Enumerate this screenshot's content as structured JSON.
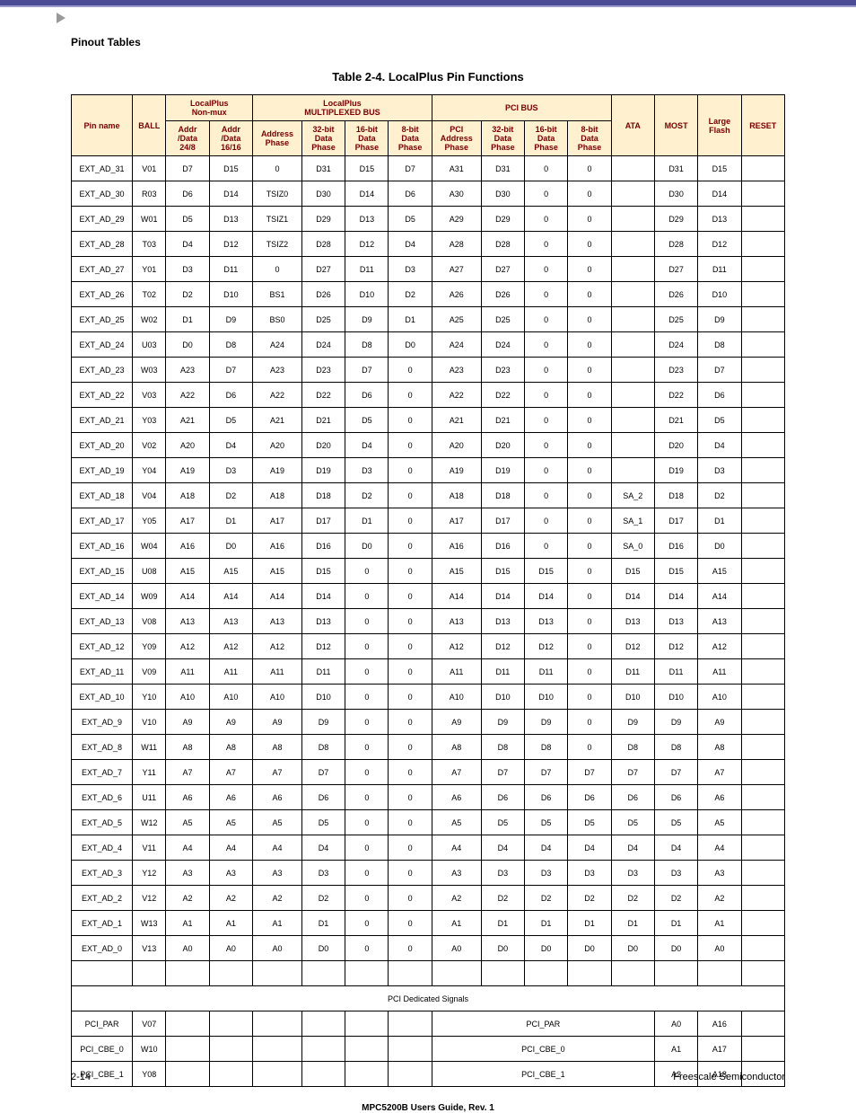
{
  "section_header": "Pinout Tables",
  "table_title": "Table 2-4. LocalPlus Pin Functions",
  "footer_center": "MPC5200B Users Guide, Rev. 1",
  "footer_left": "2-14",
  "footer_right": "Freescale Semiconductor",
  "thead": {
    "group_localplus_nonmux": "LocalPlus\nNon-mux",
    "group_localplus_mux": "LocalPlus\nMULTIPLEXED BUS",
    "group_pci": "PCI BUS",
    "pin_name": "Pin name",
    "ball": "BALL",
    "nonmux_addr248": "Addr\n/Data\n24/8",
    "nonmux_addr1616": "Addr\n/Data\n16/16",
    "mux_address_phase": "Address\nPhase",
    "mux_32bit": "32-bit\nData\nPhase",
    "mux_16bit": "16-bit\nData\nPhase",
    "mux_8bit": "8-bit\nData\nPhase",
    "pci_address_phase": "PCI\nAddress\nPhase",
    "pci_32bit": "32-bit\nData\nPhase",
    "pci_16bit": "16-bit\nData\nPhase",
    "pci_8bit": "8-bit\nData\nPhase",
    "ata": "ATA",
    "most": "MOST",
    "large_flash": "Large\nFlash",
    "reset": "RESET"
  },
  "section_label": "PCI Dedicated Signals",
  "rows": [
    {
      "pin": "EXT_AD_31",
      "ball": "V01",
      "c": [
        "D7",
        "D15",
        "0",
        "D31",
        "D15",
        "D7",
        "A31",
        "D31",
        "0",
        "0",
        "",
        "D31",
        "D15",
        ""
      ]
    },
    {
      "pin": "EXT_AD_30",
      "ball": "R03",
      "c": [
        "D6",
        "D14",
        "TSIZ0",
        "D30",
        "D14",
        "D6",
        "A30",
        "D30",
        "0",
        "0",
        "",
        "D30",
        "D14",
        ""
      ]
    },
    {
      "pin": "EXT_AD_29",
      "ball": "W01",
      "c": [
        "D5",
        "D13",
        "TSIZ1",
        "D29",
        "D13",
        "D5",
        "A29",
        "D29",
        "0",
        "0",
        "",
        "D29",
        "D13",
        ""
      ]
    },
    {
      "pin": "EXT_AD_28",
      "ball": "T03",
      "c": [
        "D4",
        "D12",
        "TSIZ2",
        "D28",
        "D12",
        "D4",
        "A28",
        "D28",
        "0",
        "0",
        "",
        "D28",
        "D12",
        ""
      ]
    },
    {
      "pin": "EXT_AD_27",
      "ball": "Y01",
      "c": [
        "D3",
        "D11",
        "0",
        "D27",
        "D11",
        "D3",
        "A27",
        "D27",
        "0",
        "0",
        "",
        "D27",
        "D11",
        ""
      ]
    },
    {
      "pin": "EXT_AD_26",
      "ball": "T02",
      "c": [
        "D2",
        "D10",
        "BS1",
        "D26",
        "D10",
        "D2",
        "A26",
        "D26",
        "0",
        "0",
        "",
        "D26",
        "D10",
        ""
      ]
    },
    {
      "pin": "EXT_AD_25",
      "ball": "W02",
      "c": [
        "D1",
        "D9",
        "BS0",
        "D25",
        "D9",
        "D1",
        "A25",
        "D25",
        "0",
        "0",
        "",
        "D25",
        "D9",
        ""
      ]
    },
    {
      "pin": "EXT_AD_24",
      "ball": "U03",
      "c": [
        "D0",
        "D8",
        "A24",
        "D24",
        "D8",
        "D0",
        "A24",
        "D24",
        "0",
        "0",
        "",
        "D24",
        "D8",
        ""
      ]
    },
    {
      "pin": "EXT_AD_23",
      "ball": "W03",
      "c": [
        "A23",
        "D7",
        "A23",
        "D23",
        "D7",
        "0",
        "A23",
        "D23",
        "0",
        "0",
        "",
        "D23",
        "D7",
        ""
      ]
    },
    {
      "pin": "EXT_AD_22",
      "ball": "V03",
      "c": [
        "A22",
        "D6",
        "A22",
        "D22",
        "D6",
        "0",
        "A22",
        "D22",
        "0",
        "0",
        "",
        "D22",
        "D6",
        ""
      ]
    },
    {
      "pin": "EXT_AD_21",
      "ball": "Y03",
      "c": [
        "A21",
        "D5",
        "A21",
        "D21",
        "D5",
        "0",
        "A21",
        "D21",
        "0",
        "0",
        "",
        "D21",
        "D5",
        ""
      ]
    },
    {
      "pin": "EXT_AD_20",
      "ball": "V02",
      "c": [
        "A20",
        "D4",
        "A20",
        "D20",
        "D4",
        "0",
        "A20",
        "D20",
        "0",
        "0",
        "",
        "D20",
        "D4",
        ""
      ]
    },
    {
      "pin": "EXT_AD_19",
      "ball": "Y04",
      "c": [
        "A19",
        "D3",
        "A19",
        "D19",
        "D3",
        "0",
        "A19",
        "D19",
        "0",
        "0",
        "",
        "D19",
        "D3",
        ""
      ]
    },
    {
      "pin": "EXT_AD_18",
      "ball": "V04",
      "c": [
        "A18",
        "D2",
        "A18",
        "D18",
        "D2",
        "0",
        "A18",
        "D18",
        "0",
        "0",
        "SA_2",
        "D18",
        "D2",
        ""
      ]
    },
    {
      "pin": "EXT_AD_17",
      "ball": "Y05",
      "c": [
        "A17",
        "D1",
        "A17",
        "D17",
        "D1",
        "0",
        "A17",
        "D17",
        "0",
        "0",
        "SA_1",
        "D17",
        "D1",
        ""
      ]
    },
    {
      "pin": "EXT_AD_16",
      "ball": "W04",
      "c": [
        "A16",
        "D0",
        "A16",
        "D16",
        "D0",
        "0",
        "A16",
        "D16",
        "0",
        "0",
        "SA_0",
        "D16",
        "D0",
        ""
      ]
    },
    {
      "pin": "EXT_AD_15",
      "ball": "U08",
      "c": [
        "A15",
        "A15",
        "A15",
        "D15",
        "0",
        "0",
        "A15",
        "D15",
        "D15",
        "0",
        "D15",
        "D15",
        "A15",
        ""
      ]
    },
    {
      "pin": "EXT_AD_14",
      "ball": "W09",
      "c": [
        "A14",
        "A14",
        "A14",
        "D14",
        "0",
        "0",
        "A14",
        "D14",
        "D14",
        "0",
        "D14",
        "D14",
        "A14",
        ""
      ]
    },
    {
      "pin": "EXT_AD_13",
      "ball": "V08",
      "c": [
        "A13",
        "A13",
        "A13",
        "D13",
        "0",
        "0",
        "A13",
        "D13",
        "D13",
        "0",
        "D13",
        "D13",
        "A13",
        ""
      ]
    },
    {
      "pin": "EXT_AD_12",
      "ball": "Y09",
      "c": [
        "A12",
        "A12",
        "A12",
        "D12",
        "0",
        "0",
        "A12",
        "D12",
        "D12",
        "0",
        "D12",
        "D12",
        "A12",
        ""
      ]
    },
    {
      "pin": "EXT_AD_11",
      "ball": "V09",
      "c": [
        "A11",
        "A11",
        "A11",
        "D11",
        "0",
        "0",
        "A11",
        "D11",
        "D11",
        "0",
        "D11",
        "D11",
        "A11",
        ""
      ]
    },
    {
      "pin": "EXT_AD_10",
      "ball": "Y10",
      "c": [
        "A10",
        "A10",
        "A10",
        "D10",
        "0",
        "0",
        "A10",
        "D10",
        "D10",
        "0",
        "D10",
        "D10",
        "A10",
        ""
      ]
    },
    {
      "pin": "EXT_AD_9",
      "ball": "V10",
      "c": [
        "A9",
        "A9",
        "A9",
        "D9",
        "0",
        "0",
        "A9",
        "D9",
        "D9",
        "0",
        "D9",
        "D9",
        "A9",
        ""
      ]
    },
    {
      "pin": "EXT_AD_8",
      "ball": "W11",
      "c": [
        "A8",
        "A8",
        "A8",
        "D8",
        "0",
        "0",
        "A8",
        "D8",
        "D8",
        "0",
        "D8",
        "D8",
        "A8",
        ""
      ]
    },
    {
      "pin": "EXT_AD_7",
      "ball": "Y11",
      "c": [
        "A7",
        "A7",
        "A7",
        "D7",
        "0",
        "0",
        "A7",
        "D7",
        "D7",
        "D7",
        "D7",
        "D7",
        "A7",
        ""
      ]
    },
    {
      "pin": "EXT_AD_6",
      "ball": "U11",
      "c": [
        "A6",
        "A6",
        "A6",
        "D6",
        "0",
        "0",
        "A6",
        "D6",
        "D6",
        "D6",
        "D6",
        "D6",
        "A6",
        ""
      ]
    },
    {
      "pin": "EXT_AD_5",
      "ball": "W12",
      "c": [
        "A5",
        "A5",
        "A5",
        "D5",
        "0",
        "0",
        "A5",
        "D5",
        "D5",
        "D5",
        "D5",
        "D5",
        "A5",
        ""
      ]
    },
    {
      "pin": "EXT_AD_4",
      "ball": "V11",
      "c": [
        "A4",
        "A4",
        "A4",
        "D4",
        "0",
        "0",
        "A4",
        "D4",
        "D4",
        "D4",
        "D4",
        "D4",
        "A4",
        ""
      ]
    },
    {
      "pin": "EXT_AD_3",
      "ball": "Y12",
      "c": [
        "A3",
        "A3",
        "A3",
        "D3",
        "0",
        "0",
        "A3",
        "D3",
        "D3",
        "D3",
        "D3",
        "D3",
        "A3",
        ""
      ]
    },
    {
      "pin": "EXT_AD_2",
      "ball": "V12",
      "c": [
        "A2",
        "A2",
        "A2",
        "D2",
        "0",
        "0",
        "A2",
        "D2",
        "D2",
        "D2",
        "D2",
        "D2",
        "A2",
        ""
      ]
    },
    {
      "pin": "EXT_AD_1",
      "ball": "W13",
      "c": [
        "A1",
        "A1",
        "A1",
        "D1",
        "0",
        "0",
        "A1",
        "D1",
        "D1",
        "D1",
        "D1",
        "D1",
        "A1",
        ""
      ]
    },
    {
      "pin": "EXT_AD_0",
      "ball": "V13",
      "c": [
        "A0",
        "A0",
        "A0",
        "D0",
        "0",
        "0",
        "A0",
        "D0",
        "D0",
        "D0",
        "D0",
        "D0",
        "A0",
        ""
      ]
    }
  ],
  "pci_rows": [
    {
      "pin": "PCI_PAR",
      "ball": "V07",
      "span": "PCI_PAR",
      "most": "A0",
      "lf": "A16"
    },
    {
      "pin": "PCI_CBE_0",
      "ball": "W10",
      "span": "PCI_CBE_0",
      "most": "A1",
      "lf": "A17"
    },
    {
      "pin": "PCI_CBE_1",
      "ball": "Y08",
      "span": "PCI_CBE_1",
      "most": "A2",
      "lf": "A18"
    }
  ]
}
